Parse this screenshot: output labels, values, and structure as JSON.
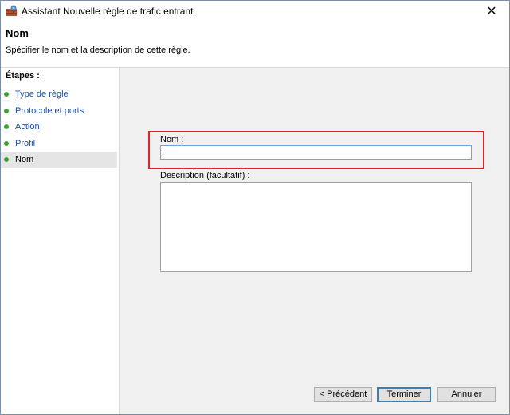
{
  "window": {
    "title": "Assistant Nouvelle règle de trafic entrant",
    "close_glyph": "✕",
    "title_icon": "firewall-rule-icon"
  },
  "header": {
    "title": "Nom",
    "subtitle": "Spécifier le nom et la description de cette règle."
  },
  "sidebar": {
    "title": "Étapes :",
    "steps": [
      {
        "label": "Type de règle"
      },
      {
        "label": "Protocole et ports"
      },
      {
        "label": "Action"
      },
      {
        "label": "Profil"
      },
      {
        "label": "Nom",
        "current": true
      }
    ],
    "dot_color": "#3ea135"
  },
  "form": {
    "name_label": "Nom :",
    "name_value": "",
    "description_label": "Description (facultatif) :",
    "description_value": "",
    "highlight_color": "#d8262c"
  },
  "buttons": {
    "back": "< Précédent",
    "finish": "Terminer",
    "cancel": "Annuler"
  }
}
